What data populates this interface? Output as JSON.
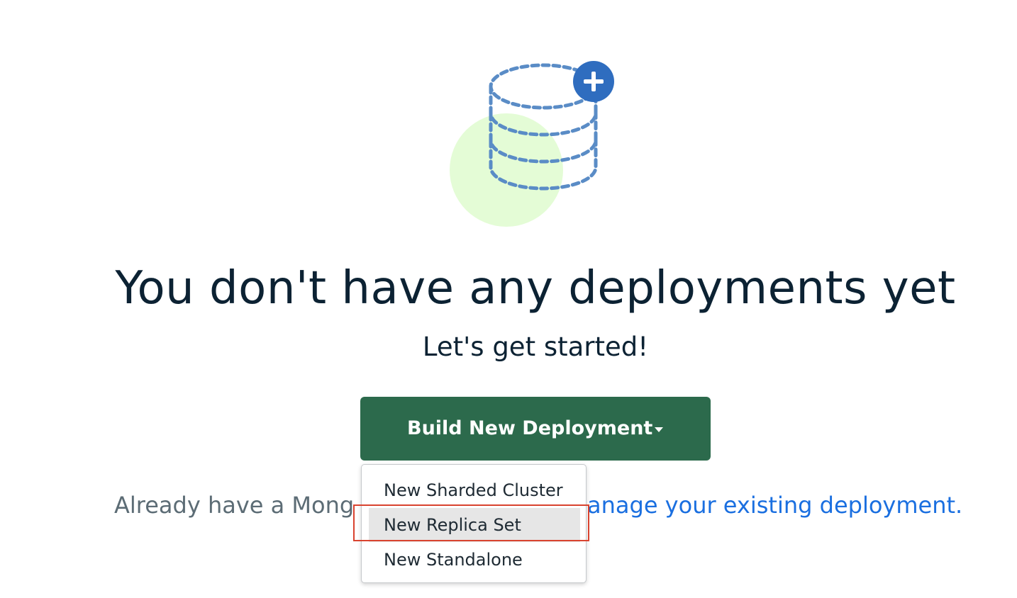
{
  "empty_state": {
    "title": "You don't have any deployments yet",
    "subtitle": "Let's get started!"
  },
  "build_button": {
    "label": "Build New Deployment"
  },
  "existing": {
    "prefix": "Already have a Mong",
    "link": "anage your existing deployment."
  },
  "dropdown": {
    "items": [
      {
        "label": "New Sharded Cluster"
      },
      {
        "label": "New Replica Set"
      },
      {
        "label": "New Standalone"
      }
    ],
    "selected_index": 1
  },
  "colors": {
    "primary_button": "#2c6a4c",
    "link": "#1a6fe0",
    "title_text": "#0c2233",
    "highlight_border": "#d9432f",
    "illustration_blue": "#5a8cc6",
    "illustration_green": "#e4fcd6"
  },
  "icons": {
    "illustration": "database-stack-add-icon",
    "caret": "caret-down-icon",
    "add_badge": "plus-icon"
  }
}
